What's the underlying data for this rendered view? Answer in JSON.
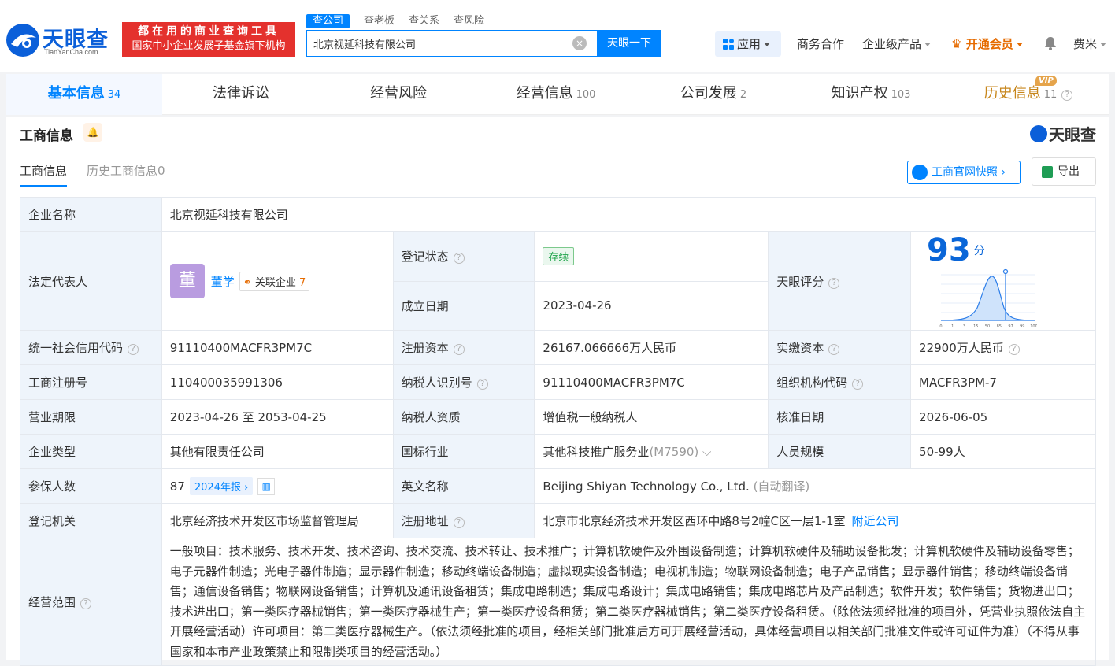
{
  "header": {
    "logo_text": "天眼查",
    "logo_sub": "TianYanCha.com",
    "slogan_1": "都在用的商业查询工具",
    "slogan_2": "国家中小企业发展子基金旗下机构",
    "search_tabs": [
      "查公司",
      "查老板",
      "查关系",
      "查风险"
    ],
    "search_value": "北京视延科技有限公司",
    "search_button": "天眼一下",
    "nav": {
      "apps": "应用",
      "business": "商务合作",
      "enterprise": "企业级产品",
      "vip": "开通会员",
      "user": "费米"
    }
  },
  "tabs": [
    {
      "label": "基本信息",
      "count": "34"
    },
    {
      "label": "法律诉讼",
      "count": ""
    },
    {
      "label": "经营风险",
      "count": ""
    },
    {
      "label": "经营信息",
      "count": "100"
    },
    {
      "label": "公司发展",
      "count": "2"
    },
    {
      "label": "知识产权",
      "count": "103"
    },
    {
      "label": "历史信息",
      "count": "11"
    }
  ],
  "vip_badge": "VIP",
  "section": {
    "title": "工商信息",
    "brand": "天眼查",
    "subtab_active": "工商信息",
    "subtab_history": "历史工商信息0",
    "snapshot_button": "工商官网快照",
    "export_button": "导出"
  },
  "info": {
    "company_name_label": "企业名称",
    "company_name": "北京视延科技有限公司",
    "legal_rep_label": "法定代表人",
    "legal_rep_avatar": "董",
    "legal_rep_name": "董学",
    "related_label": "关联企业",
    "related_count": "7",
    "reg_status_label": "登记状态",
    "reg_status": "存续",
    "found_date_label": "成立日期",
    "found_date": "2023-04-26",
    "score_label": "天眼评分",
    "score": "93",
    "score_unit": "分",
    "credit_code_label": "统一社会信用代码",
    "credit_code": "91110400MACFR3PM7C",
    "reg_capital_label": "注册资本",
    "reg_capital": "26167.066666万人民币",
    "paid_capital_label": "实缴资本",
    "paid_capital": "22900万人民币",
    "reg_no_label": "工商注册号",
    "reg_no": "110400035991306",
    "taxpayer_id_label": "纳税人识别号",
    "taxpayer_id": "91110400MACFR3PM7C",
    "org_code_label": "组织机构代码",
    "org_code": "MACFR3PM-7",
    "term_label": "营业期限",
    "term": "2023-04-26 至 2053-04-25",
    "taxpayer_type_label": "纳税人资质",
    "taxpayer_type": "增值税一般纳税人",
    "approve_date_label": "核准日期",
    "approve_date": "2026-06-05",
    "company_type_label": "企业类型",
    "company_type": "其他有限责任公司",
    "industry_label": "国标行业",
    "industry": "其他科技推广服务业",
    "industry_code": "(M7590)",
    "staff_label": "人员规模",
    "staff": "50-99人",
    "insured_label": "参保人数",
    "insured": "87",
    "insured_year": "2024年报",
    "en_name_label": "英文名称",
    "en_name": "Beijing Shiyan Technology Co., Ltd.",
    "en_name_note": "(自动翻译)",
    "authority_label": "登记机关",
    "authority": "北京经济技术开发区市场监督管理局",
    "address_label": "注册地址",
    "address": "北京市北京经济技术开发区西环中路8号2幢C区一层1-1室",
    "nearby_link": "附近公司",
    "scope_label": "经营范围",
    "scope": "一般项目：技术服务、技术开发、技术咨询、技术交流、技术转让、技术推广；计算机软硬件及外围设备制造；计算机软硬件及辅助设备批发；计算机软硬件及辅助设备零售；电子元器件制造；光电子器件制造；显示器件制造；移动终端设备制造；虚拟现实设备制造；电视机制造；物联网设备制造；电子产品销售；显示器件销售；移动终端设备销售；通信设备销售；物联网设备销售；计算机及通讯设备租赁；集成电路制造；集成电路设计；集成电路销售；集成电路芯片及产品制造；软件开发；软件销售；货物进出口；技术进出口；第一类医疗器械销售；第一类医疗器械生产；第一类医疗设备租赁；第二类医疗器械销售；第二类医疗设备租赁。（除依法须经批准的项目外，凭营业执照依法自主开展经营活动）许可项目：第二类医疗器械生产。（依法须经批准的项目，经相关部门批准后方可开展经营活动，具体经营项目以相关部门批准文件或许可证件为准）（不得从事国家和本市产业政策禁止和限制类项目的经营活动。）"
  },
  "score_chart": {
    "x_ticks": [
      "0",
      "1",
      "3",
      "15",
      "50",
      "85",
      "97",
      "99",
      "100"
    ],
    "marker_value": "93"
  },
  "colors": {
    "accent": "#0084ff",
    "brand": "#0b5fd9",
    "slogan_bg": "#e4312d",
    "vip": "#e66b00"
  }
}
